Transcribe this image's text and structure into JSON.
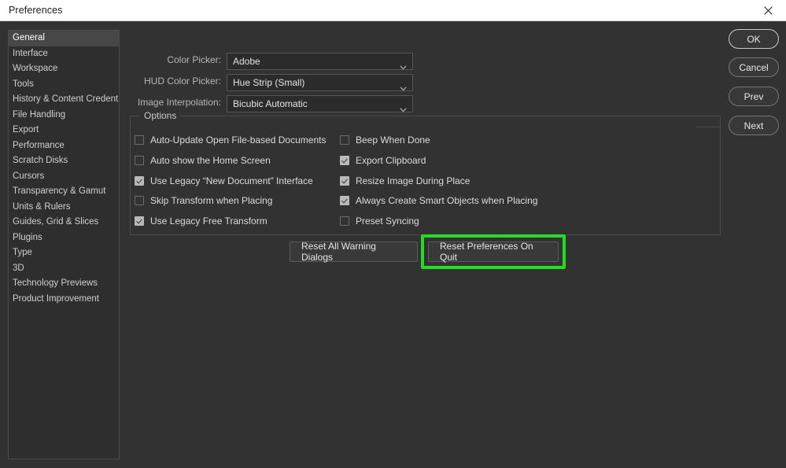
{
  "window": {
    "title": "Preferences",
    "close_icon": "close-icon"
  },
  "sidebar": {
    "items": [
      {
        "label": "General",
        "selected": true
      },
      {
        "label": "Interface",
        "selected": false
      },
      {
        "label": "Workspace",
        "selected": false
      },
      {
        "label": "Tools",
        "selected": false
      },
      {
        "label": "History & Content Credentials",
        "selected": false
      },
      {
        "label": "File Handling",
        "selected": false
      },
      {
        "label": "Export",
        "selected": false
      },
      {
        "label": "Performance",
        "selected": false
      },
      {
        "label": "Scratch Disks",
        "selected": false
      },
      {
        "label": "Cursors",
        "selected": false
      },
      {
        "label": "Transparency & Gamut",
        "selected": false
      },
      {
        "label": "Units & Rulers",
        "selected": false
      },
      {
        "label": "Guides, Grid & Slices",
        "selected": false
      },
      {
        "label": "Plugins",
        "selected": false
      },
      {
        "label": "Type",
        "selected": false
      },
      {
        "label": "3D",
        "selected": false
      },
      {
        "label": "Technology Previews",
        "selected": false
      },
      {
        "label": "Product Improvement",
        "selected": false
      }
    ]
  },
  "fields": [
    {
      "label": "Color Picker:",
      "value": "Adobe",
      "arrow_icon": "chevron-down-icon"
    },
    {
      "label": "HUD Color Picker:",
      "value": "Hue Strip (Small)",
      "arrow_icon": "chevron-down-icon"
    },
    {
      "label": "Image Interpolation:",
      "value": "Bicubic Automatic",
      "arrow_icon": "chevron-down-icon"
    }
  ],
  "options": {
    "legend": "Options",
    "left_column": [
      {
        "label": "Auto-Update Open File-based Documents",
        "checked": false
      },
      {
        "label": "Auto show the Home Screen",
        "checked": false
      },
      {
        "label": "Use Legacy “New Document” Interface",
        "checked": true
      },
      {
        "label": "Skip Transform when Placing",
        "checked": false
      },
      {
        "label": "Use Legacy Free Transform",
        "checked": true
      }
    ],
    "right_column": [
      {
        "label": "Beep When Done",
        "checked": false
      },
      {
        "label": "Export Clipboard",
        "checked": true
      },
      {
        "label": "Resize Image During Place",
        "checked": true
      },
      {
        "label": "Always Create Smart Objects when Placing",
        "checked": true
      },
      {
        "label": "Preset Syncing",
        "checked": false
      }
    ]
  },
  "reset_buttons": [
    {
      "label": "Reset All Warning Dialogs",
      "highlighted": false
    },
    {
      "label": "Reset Preferences On Quit",
      "highlighted": true
    }
  ],
  "action_buttons": [
    {
      "label": "OK",
      "primary": true
    },
    {
      "label": "Cancel",
      "primary": false
    },
    {
      "label": "Prev",
      "primary": false
    },
    {
      "label": "Next",
      "primary": false
    }
  ],
  "annotation": {
    "highlight_color": "#22dd22"
  }
}
